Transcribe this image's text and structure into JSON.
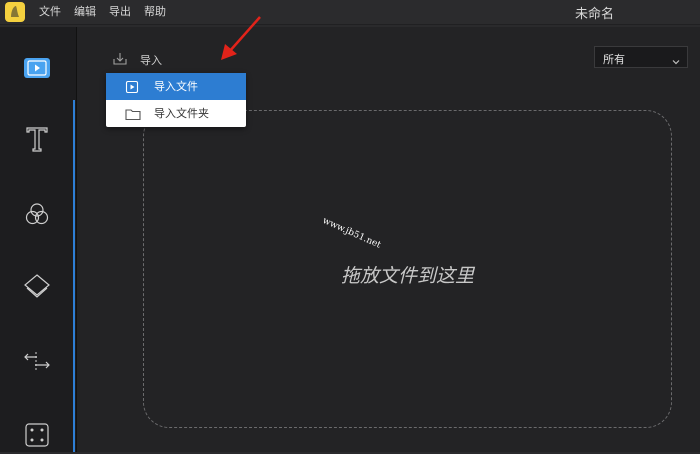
{
  "app": {
    "title": "未命名",
    "menu": [
      "文件",
      "编辑",
      "导出",
      "帮助"
    ]
  },
  "toolbar": {
    "import_label": "导入",
    "filter_value": "所有"
  },
  "import_menu": {
    "items": [
      "导入文件",
      "导入文件夹"
    ],
    "selected_index": 0
  },
  "dropzone": {
    "text": "拖放文件到这里"
  },
  "watermark": "www.jb51.net",
  "colors": {
    "accent": "#2d7dd2",
    "arrow": "#e2231a",
    "logo": "#f4d03f"
  },
  "sidebar": {
    "icons": [
      "media-icon",
      "text-icon",
      "filters-icon",
      "overlays-icon",
      "transitions-icon",
      "elements-icon"
    ]
  }
}
